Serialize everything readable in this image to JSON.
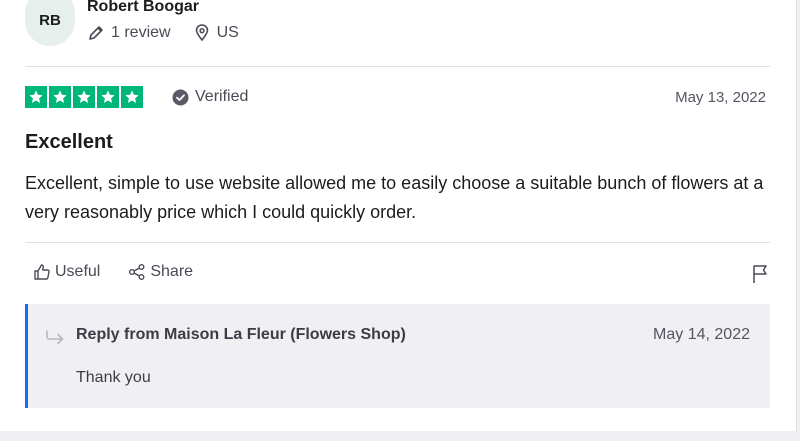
{
  "reviewer": {
    "initials": "RB",
    "name": "Robert Boogar",
    "reviews": "1 review",
    "country": "US"
  },
  "review": {
    "rating": 5,
    "verified_label": "Verified",
    "date": "May 13, 2022",
    "title": "Excellent",
    "text": "Excellent, simple to use website allowed me to easily choose a suitable bunch of flowers at a very reasonably price which I could quickly order."
  },
  "actions": {
    "useful_label": "Useful",
    "share_label": "Share"
  },
  "reply": {
    "from": "Reply from Maison La Fleur (Flowers Shop)",
    "date": "May 14, 2022",
    "text": "Thank you"
  },
  "colors": {
    "star_green": "#00b67a",
    "reply_accent": "#1a6af5"
  }
}
